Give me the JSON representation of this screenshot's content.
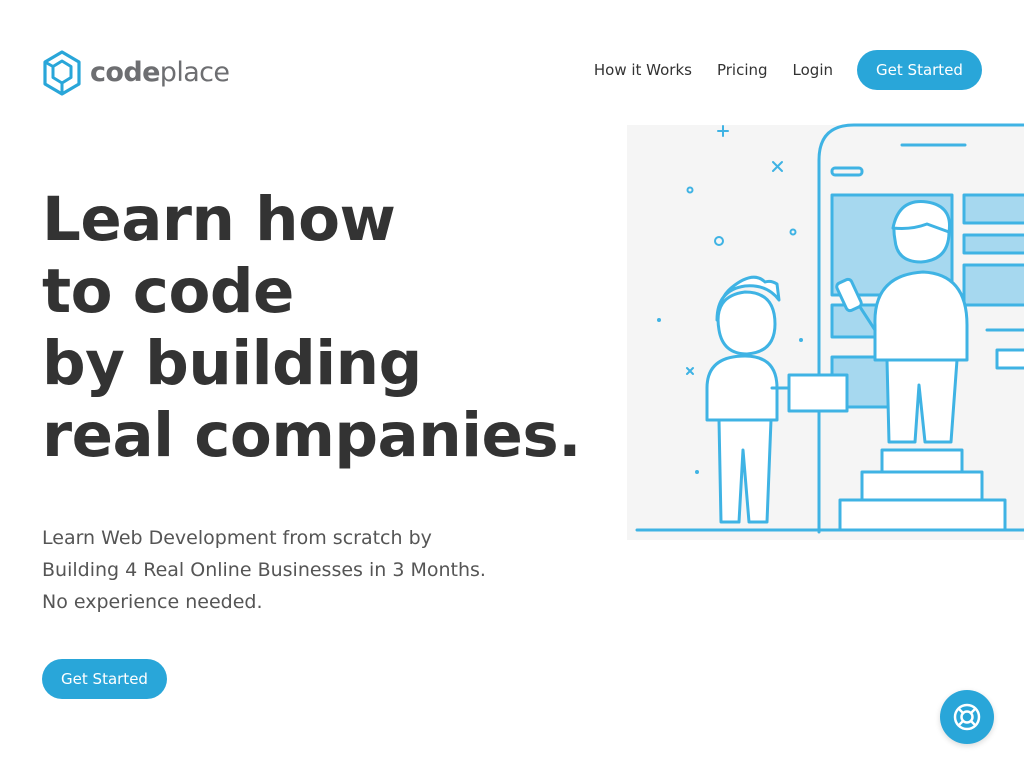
{
  "brand": {
    "name_bold": "code",
    "name_light": "place",
    "accent_color": "#29a6d9",
    "logo_icon": "hexagon-logo-icon"
  },
  "nav": {
    "items": [
      {
        "label": "How it Works"
      },
      {
        "label": "Pricing"
      },
      {
        "label": "Login"
      }
    ],
    "cta_label": "Get Started"
  },
  "hero": {
    "title_lines": [
      "Learn how",
      "to code",
      "by building",
      "real companies."
    ],
    "subtitle_lines": [
      "Learn Web Development from scratch by",
      "Building 4 Real Online Businesses in 3 Months.",
      "No experience needed."
    ],
    "cta_label": "Get Started"
  },
  "illustration": {
    "icon": "developers-building-website-illustration"
  },
  "help_widget": {
    "icon": "lifebuoy-icon"
  }
}
